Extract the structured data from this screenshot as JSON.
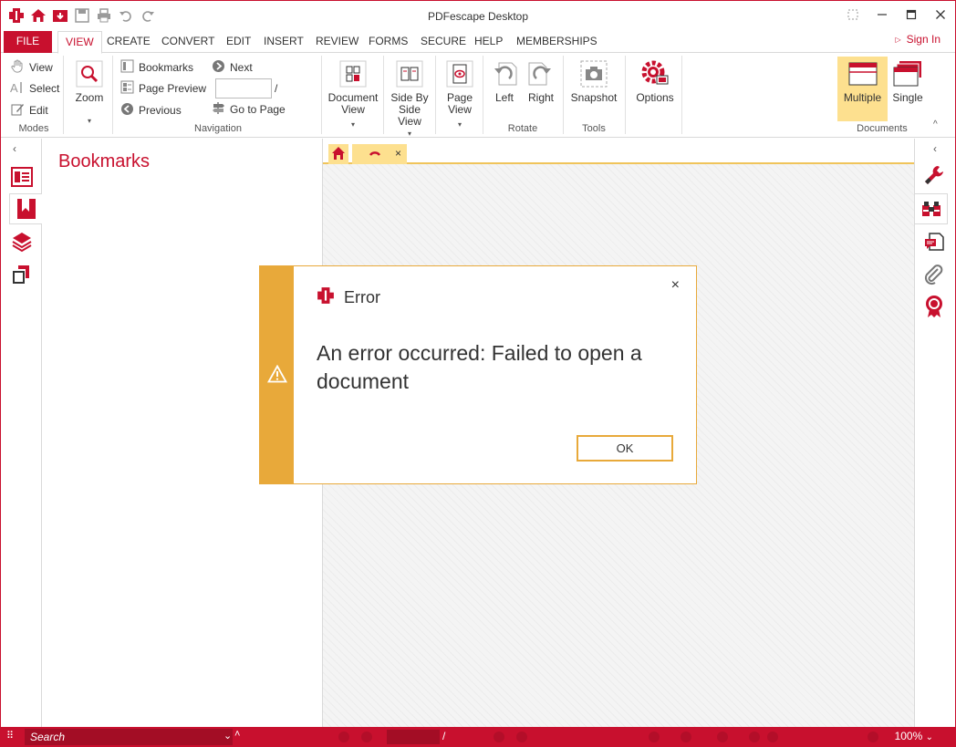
{
  "app": {
    "title": "PDFescape Desktop",
    "accent_color": "#c8102e",
    "highlight_color": "#fde08f"
  },
  "quick_access": [
    "logo-icon",
    "home-icon",
    "open-icon",
    "save-icon",
    "print-icon",
    "undo-icon",
    "redo-icon"
  ],
  "tabs": [
    {
      "label": "FILE"
    },
    {
      "label": "VIEW"
    },
    {
      "label": "CREATE"
    },
    {
      "label": "CONVERT"
    },
    {
      "label": "EDIT"
    },
    {
      "label": "INSERT"
    },
    {
      "label": "REVIEW"
    },
    {
      "label": "FORMS"
    },
    {
      "label": "SECURE"
    },
    {
      "label": "HELP"
    },
    {
      "label": "MEMBERSHIPS"
    }
  ],
  "active_tab": "VIEW",
  "signin": "Sign In",
  "ribbon": {
    "modes": {
      "label": "Modes",
      "view": "View",
      "select": "Select",
      "edit": "Edit"
    },
    "zoom": {
      "label": "Zoom"
    },
    "navigation": {
      "label": "Navigation",
      "bookmarks": "Bookmarks",
      "page_preview": "Page Preview",
      "previous": "Previous",
      "next": "Next",
      "page_sep": "/",
      "go_to_page": "Go to Page"
    },
    "document_view": {
      "line1": "Document",
      "line2": "View"
    },
    "side_by_side": {
      "line1": "Side By",
      "line2": "Side",
      "line3": "View"
    },
    "page_view": {
      "line1": "Page",
      "line2": "View"
    },
    "rotate": {
      "label": "Rotate",
      "left": "Left",
      "right": "Right"
    },
    "tools": {
      "label": "Tools",
      "snapshot": "Snapshot"
    },
    "options": "Options",
    "documents": {
      "label": "Documents",
      "multiple": "Multiple",
      "single": "Single"
    }
  },
  "bookmarks_panel": {
    "title": "Bookmarks"
  },
  "doc_tabs": {
    "close": "×"
  },
  "status": {
    "search_placeholder": "Search",
    "page_sep": "/",
    "zoom": "100%"
  },
  "dialog": {
    "title": "Error",
    "message": "An error occurred: Failed to open a document",
    "ok_label": "OK",
    "close": "×"
  }
}
